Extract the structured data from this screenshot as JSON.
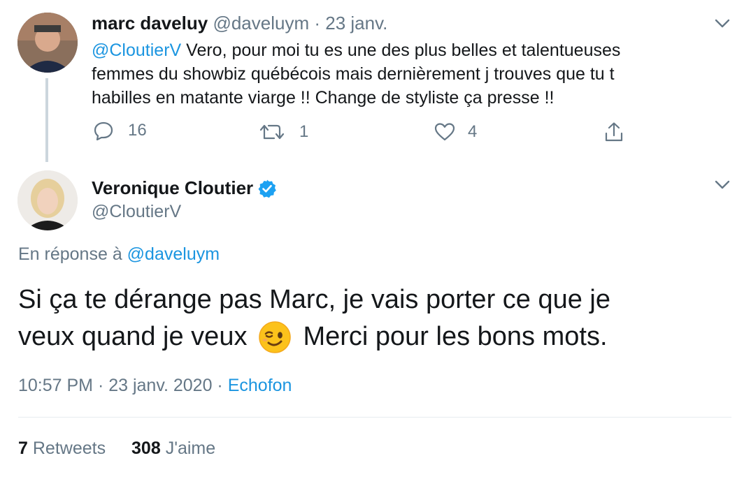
{
  "reply_tweet": {
    "display_name": "marc daveluy",
    "handle": "@daveluym",
    "date": "· 23 janv.",
    "mention": "@CloutierV",
    "text_line1": "Vero, pour moi tu es une des plus belles et talentueuses",
    "text_line2": "femmes du showbiz québécois mais dernièrement j trouves que tu t",
    "text_line3": "habilles en matante viarge !! Change de styliste ça presse !!",
    "replies": "16",
    "retweets": "1",
    "likes": "4"
  },
  "main_tweet": {
    "display_name": "Veronique Cloutier",
    "handle": "@CloutierV",
    "in_reply_prefix": "En réponse à",
    "in_reply_handle": "@daveluym",
    "text_line1": "Si ça te dérange pas Marc, je vais porter ce que je",
    "text_line2a": "veux quand je veux",
    "text_line2b": "Merci pour les bons mots.",
    "time": "10:57 PM · 23 janv. 2020 ·",
    "source": "Echofon",
    "retweet_count": "7",
    "retweet_label": "Retweets",
    "like_count": "308",
    "like_label": "J'aime"
  },
  "colors": {
    "link": "#1b95e0",
    "muted": "#657786",
    "verified": "#1da1f2"
  }
}
